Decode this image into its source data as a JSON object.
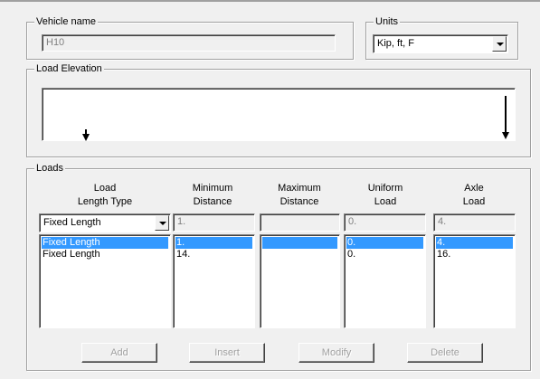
{
  "vehicle": {
    "title": "Vehicle name",
    "name_value": "H10"
  },
  "units": {
    "title": "Units",
    "selected": "Kip, ft, F"
  },
  "elevation": {
    "title": "Load Elevation"
  },
  "loads": {
    "title": "Loads",
    "headers": {
      "length_type": [
        "Load",
        "Length Type"
      ],
      "min_distance": [
        "Minimum",
        "Distance"
      ],
      "max_distance": [
        "Maximum",
        "Distance"
      ],
      "uniform_load": [
        "Uniform",
        "Load"
      ],
      "axle_load": [
        "Axle",
        "Load"
      ]
    },
    "edit_row": {
      "length_type": "Fixed Length",
      "min_distance": "1.",
      "max_distance": "",
      "uniform_load": "0.",
      "axle_load": "4."
    },
    "rows": [
      {
        "length_type": "Fixed Length",
        "min_distance": "1.",
        "max_distance": "",
        "uniform_load": "0.",
        "axle_load": "4.",
        "selected": true
      },
      {
        "length_type": "Fixed Length",
        "min_distance": "14.",
        "max_distance": "",
        "uniform_load": "0.",
        "axle_load": "16.",
        "selected": false
      }
    ],
    "buttons": {
      "add": "Add",
      "insert": "Insert",
      "modify": "Modify",
      "delete": "Delete"
    }
  }
}
